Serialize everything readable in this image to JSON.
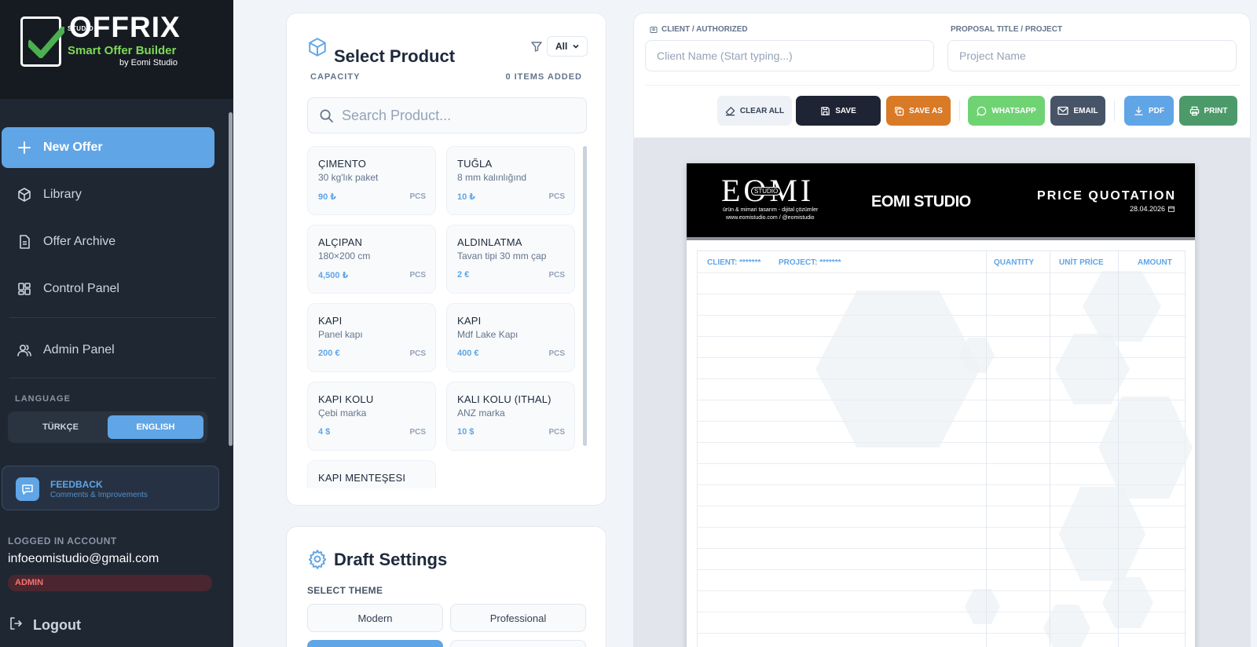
{
  "brand": {
    "studio": "STUDIO",
    "name": "OFFRIX",
    "tagline": "Smart Offer Builder",
    "by": "by Eomi Studio"
  },
  "nav": {
    "new_offer": "New Offer",
    "library": "Library",
    "offer_archive": "Offer Archive",
    "control_panel": "Control Panel",
    "admin_panel": "Admin Panel"
  },
  "language": {
    "title": "LANGUAGE",
    "options": [
      "TÜRKÇE",
      "ENGLISH"
    ],
    "selected": "ENGLISH"
  },
  "feedback": {
    "title": "FEEDBACK",
    "subtitle": "Comments & Improvements"
  },
  "account": {
    "title": "LOGGED IN ACCOUNT",
    "email": "infoeomistudio@gmail.com",
    "role": "ADMIN",
    "logout": "Logout"
  },
  "product_panel": {
    "title": "Select Product",
    "filter_value": "All",
    "capacity_label": "CAPACITY",
    "items_added": "0 ITEMS ADDED",
    "search_placeholder": "Search Product...",
    "items": [
      {
        "name": "ÇIMENTO",
        "desc": "30 kg'lık paket",
        "price": "90 ₺",
        "unit": "PCS"
      },
      {
        "name": "TUĞLA",
        "desc": "8 mm kalınlığınd",
        "price": "10 ₺",
        "unit": "PCS"
      },
      {
        "name": "ALÇIPAN",
        "desc": "180×200 cm",
        "price": "4,500 ₺",
        "unit": "PCS"
      },
      {
        "name": "ALDINLATMA",
        "desc": "Tavan tipi 30 mm çap",
        "price": "2 €",
        "unit": "PCS"
      },
      {
        "name": "KAPI",
        "desc": "Panel kapı",
        "price": "200 €",
        "unit": "PCS"
      },
      {
        "name": "KAPI",
        "desc": "Mdf Lake Kapı",
        "price": "400 €",
        "unit": "PCS"
      },
      {
        "name": "KAPI KOLU",
        "desc": "Çebi marka",
        "price": "4 $",
        "unit": "PCS"
      },
      {
        "name": "KALI KOLU (ITHAL)",
        "desc": "ANZ marka",
        "price": "10 $",
        "unit": "PCS"
      },
      {
        "name": "KAPI MENTEŞESI",
        "desc": "",
        "price": "",
        "unit": ""
      }
    ]
  },
  "draft": {
    "title": "Draft Settings",
    "theme_label": "SELECT THEME",
    "themes": [
      "Modern",
      "Professional"
    ]
  },
  "proposal": {
    "client_label": "CLIENT / AUTHORIZED",
    "client_placeholder": "Client Name (Start typing...)",
    "project_label": "PROPOSAL TITLE / PROJECT",
    "project_placeholder": "Project Name"
  },
  "toolbar": {
    "clear_all": "CLEAR ALL",
    "save": "SAVE",
    "save_as": "SAVE AS",
    "whatsapp": "WHATSAPP",
    "email": "EMAIL",
    "pdf": "PDF",
    "print": "PRINT"
  },
  "document": {
    "logo_text": "EOMI",
    "logo_studio": "STUDIO",
    "logo_tagline": "ürün & mimari tasarım - dijital çözümler",
    "logo_web": "www.eomistudio.com / @eomistudio",
    "company": "EOMI STUDIO",
    "title": "PRICE QUOTATION",
    "date": "28.04.2026",
    "client_col": "CLIENT: *******",
    "project_col": "PROJECT: *******",
    "quantity_col": "QUANTITY",
    "unit_price_col": "UNİT PRİCE",
    "amount_col": "AMOUNT"
  },
  "colors": {
    "accent": "#60a5e6",
    "sidebar": "#1f2733",
    "save": "#1e2433",
    "save_as": "#d97a27",
    "whatsapp": "#6fd373",
    "email": "#475467",
    "pdf": "#60a5e6",
    "print": "#4c9a6a"
  }
}
